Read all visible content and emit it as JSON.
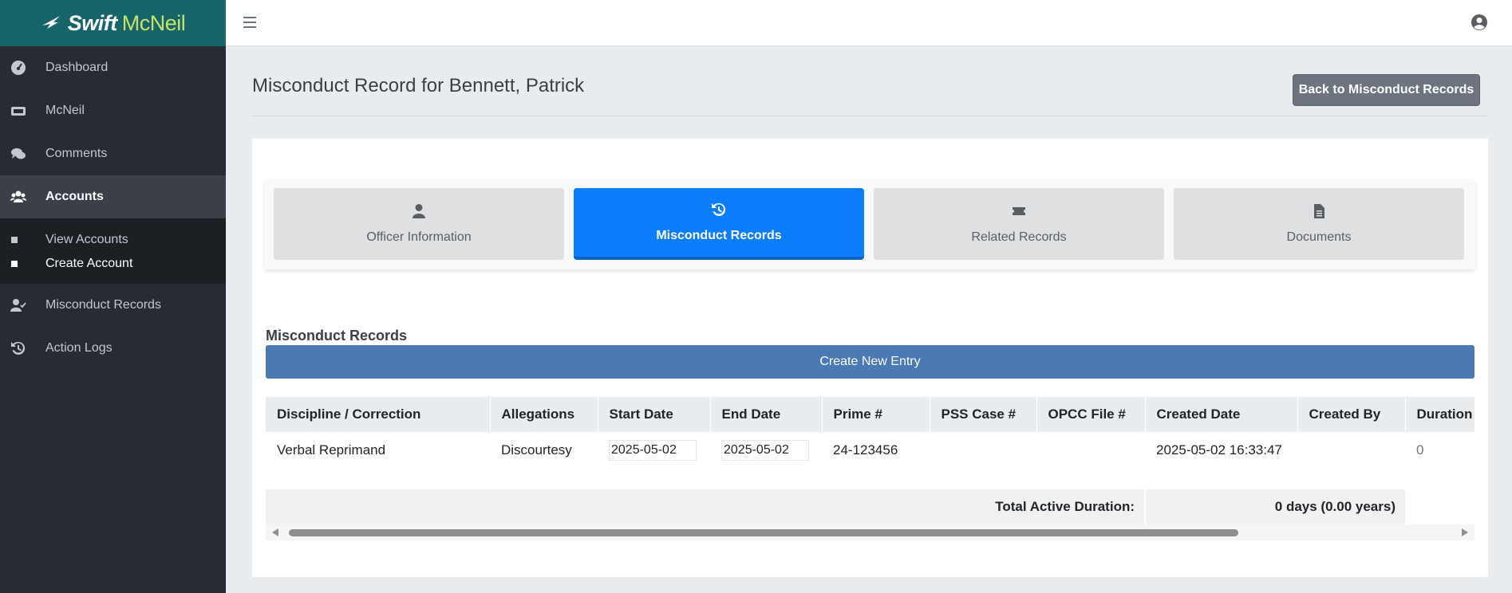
{
  "brand": {
    "name": "Swift",
    "accent": "McNeil"
  },
  "sidebar": {
    "items": [
      {
        "label": "Dashboard",
        "icon": "dashboard-gauge-icon"
      },
      {
        "label": "McNeil",
        "icon": "ticket-icon"
      },
      {
        "label": "Comments",
        "icon": "comments-icon"
      },
      {
        "label": "Accounts",
        "icon": "users-icon",
        "active": true
      },
      {
        "label": "Misconduct Records",
        "icon": "user-check-icon"
      },
      {
        "label": "Action Logs",
        "icon": "history-icon"
      }
    ],
    "subitems": [
      {
        "label": "View Accounts"
      },
      {
        "label": "Create Account",
        "active": true
      }
    ]
  },
  "topbar": {
    "menu_icon": "hamburger-icon",
    "user_icon": "user-circle-icon"
  },
  "page": {
    "title": "Misconduct Record for Bennett, Patrick",
    "back_button": "Back to Misconduct Records"
  },
  "tabs": [
    {
      "label": "Officer Information",
      "icon": "user-icon"
    },
    {
      "label": "Misconduct Records",
      "icon": "history-icon",
      "active": true
    },
    {
      "label": "Related Records",
      "icon": "ticket-icon"
    },
    {
      "label": "Documents",
      "icon": "file-icon"
    }
  ],
  "section": {
    "title": "Misconduct Records",
    "create_button": "Create New Entry"
  },
  "table": {
    "columns": [
      "Discipline / Correction",
      "Allegations",
      "Start Date",
      "End Date",
      "Prime #",
      "PSS Case #",
      "OPCC File #",
      "Created Date",
      "Created By",
      "Duration"
    ],
    "rows": [
      {
        "discipline": "Verbal Reprimand",
        "allegations": "Discourtesy",
        "start_date": "2025-05-02",
        "end_date": "2025-05-02",
        "prime": "24-123456",
        "pss_case": "",
        "opcc_file": "",
        "created_date": "2025-05-02 16:33:47",
        "created_by": "",
        "duration": "0"
      }
    ],
    "total_label": "Total Active Duration:",
    "total_value": "0 days (0.00 years)"
  },
  "colors": {
    "brand_bg": "#15656a",
    "sidebar_bg": "#272b33",
    "active_tab": "#0a7dfa",
    "create_button": "#4a79b4",
    "back_button": "#6c757d"
  }
}
